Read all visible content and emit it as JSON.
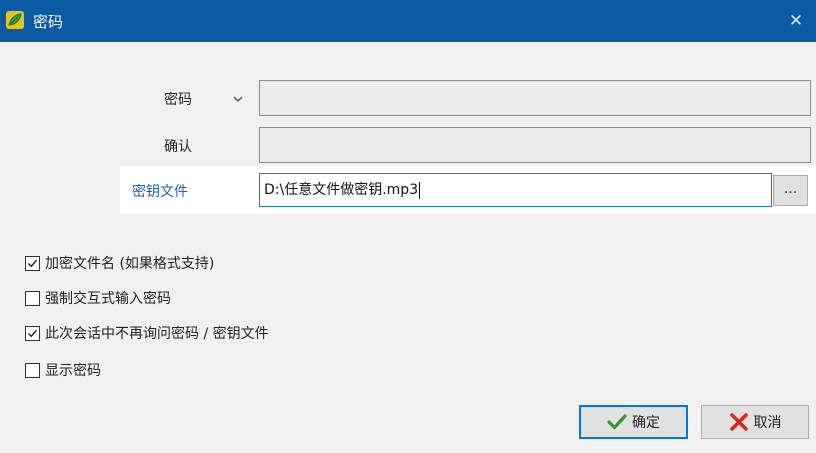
{
  "window": {
    "title": "密码",
    "close_icon": "close-icon"
  },
  "form": {
    "password_label": "密码",
    "password_value": "",
    "confirm_label": "确认",
    "confirm_value": "",
    "keyfile_label": "密钥文件",
    "keyfile_value": "D:\\任意文件做密钥.mp3",
    "browse_label": "..."
  },
  "options": [
    {
      "label": "加密文件名 (如果格式支持)",
      "checked": true
    },
    {
      "label": "强制交互式输入密码",
      "checked": false
    },
    {
      "label": "此次会话中不再询问密码 / 密钥文件",
      "checked": true
    },
    {
      "label": "显示密码",
      "checked": false
    }
  ],
  "buttons": {
    "ok_label": "确定",
    "cancel_label": "取消"
  },
  "colors": {
    "titlebar": "#0b5aa4",
    "accent": "#1c63b8",
    "ok_check": "#2c9a2c",
    "cancel_x": "#d9261c"
  }
}
